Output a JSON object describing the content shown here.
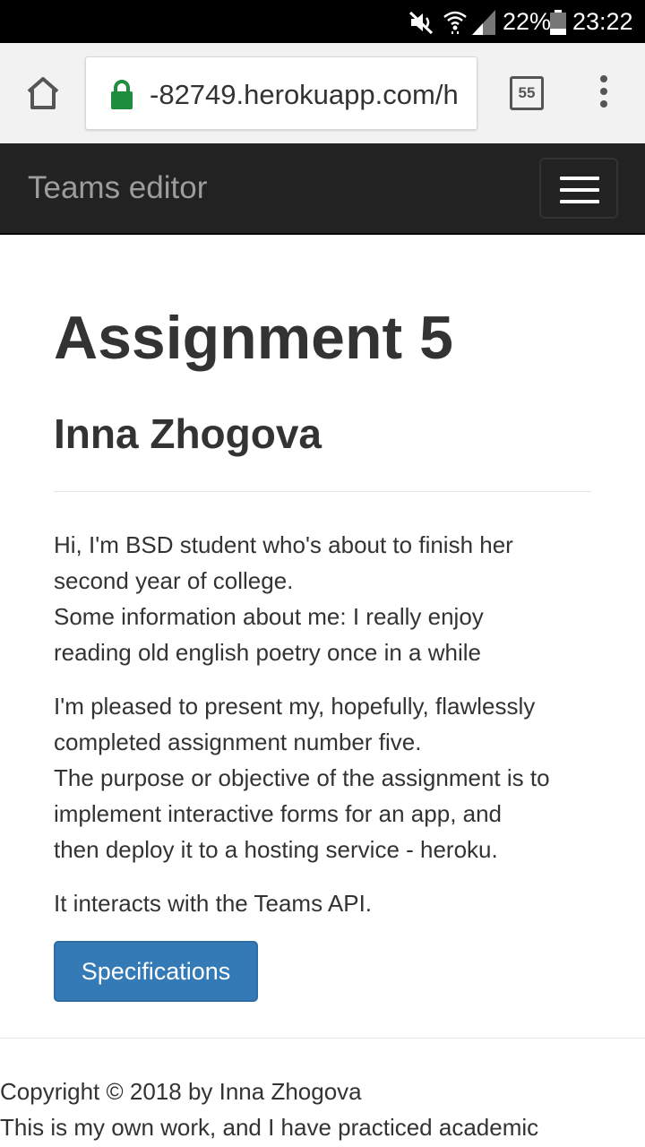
{
  "status_bar": {
    "battery_percent": "22%",
    "time": "23:22",
    "icons": [
      "mute-icon",
      "wifi-icon",
      "signal-icon",
      "battery-icon"
    ]
  },
  "browser": {
    "url": "-82749.herokuapp.com/h",
    "tab_count": "55",
    "icons": [
      "home-icon",
      "lock-icon",
      "tabs-icon",
      "more-vertical-icon"
    ],
    "lock_color": "#1e8e3e"
  },
  "navbar": {
    "brand": "Teams editor",
    "background": "#222222",
    "icons": [
      "hamburger-menu-icon"
    ]
  },
  "main": {
    "title": "Assignment 5",
    "subtitle": "Inna Zhogova",
    "intro_lines": [
      "Hi, I'm BSD student who's about to finish her",
      "second year of college.",
      "Some information about me: I really enjoy",
      "reading old english poetry once in a while"
    ],
    "description_lines": [
      "I'm pleased to present my, hopefully, flawlessly",
      "completed assignment number five.",
      "The purpose or objective of the assignment is to",
      "implement interactive forms for an app, and",
      "then deploy it to a hosting service - heroku."
    ],
    "api_note": "It interacts with the Teams API.",
    "spec_button_label": "Specifications",
    "button_color": "#337ab7"
  },
  "footer": {
    "copyright": "Copyright © 2018 by Inna Zhogova",
    "statement": "This is my own work, and I have practiced academic"
  }
}
